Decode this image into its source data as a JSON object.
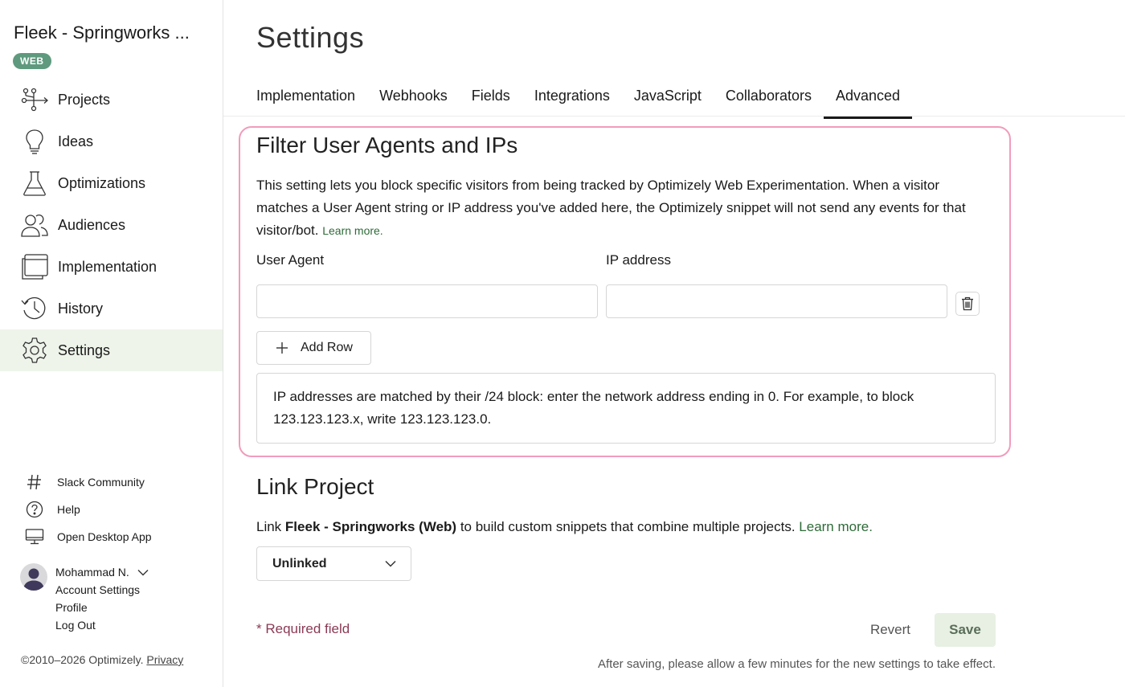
{
  "sidebar": {
    "project_title": "Fleek - Springworks ...",
    "badge": "WEB",
    "nav": [
      {
        "label": "Projects",
        "icon": "projects-icon"
      },
      {
        "label": "Ideas",
        "icon": "lightbulb-icon"
      },
      {
        "label": "Optimizations",
        "icon": "flask-icon"
      },
      {
        "label": "Audiences",
        "icon": "users-icon"
      },
      {
        "label": "Implementation",
        "icon": "window-icon"
      },
      {
        "label": "History",
        "icon": "history-icon"
      },
      {
        "label": "Settings",
        "icon": "gear-icon",
        "active": true
      }
    ],
    "links": {
      "slack": "Slack Community",
      "help": "Help",
      "desktop": "Open Desktop App"
    },
    "user": {
      "name": "Mohammad N.",
      "account_settings": "Account Settings",
      "profile": "Profile",
      "logout": "Log Out"
    },
    "copyright": "©2010–2026 Optimizely.",
    "privacy": "Privacy"
  },
  "page": {
    "title": "Settings",
    "tabs": [
      {
        "label": "Implementation"
      },
      {
        "label": "Webhooks"
      },
      {
        "label": "Fields"
      },
      {
        "label": "Integrations"
      },
      {
        "label": "JavaScript"
      },
      {
        "label": "Collaborators"
      },
      {
        "label": "Advanced",
        "active": true
      }
    ]
  },
  "filter": {
    "heading": "Filter User Agents and IPs",
    "description": "This setting lets you block specific visitors from being tracked by Optimizely Web Experimentation. When a visitor matches a User Agent string or IP address you've added here, the Optimizely snippet will not send any events for that visitor/bot.",
    "learn_more": "Learn more.",
    "user_agent_label": "User Agent",
    "ip_label": "IP address",
    "user_agent_value": "",
    "ip_value": "",
    "add_row": "Add Row",
    "info": "IP addresses are matched by their /24 block: enter the network address ending in 0. For example, to block 123.123.123.x, write 123.123.123.0."
  },
  "link_project": {
    "heading": "Link Project",
    "prefix": "Link",
    "project_name": "Fleek - Springworks (Web)",
    "suffix": "to build custom snippets that combine multiple projects.",
    "learn_more": "Learn more.",
    "select_value": "Unlinked"
  },
  "footer": {
    "required": "* Required field",
    "revert": "Revert",
    "save": "Save",
    "after_save": "After saving, please allow a few minutes for the new settings to take effect."
  },
  "colors": {
    "accent_green": "#5f9a7e",
    "active_nav_bg": "#eef4ea",
    "highlight_border": "#f19cbc",
    "link_green": "#2e6b38",
    "required_text": "#8a3a55"
  }
}
